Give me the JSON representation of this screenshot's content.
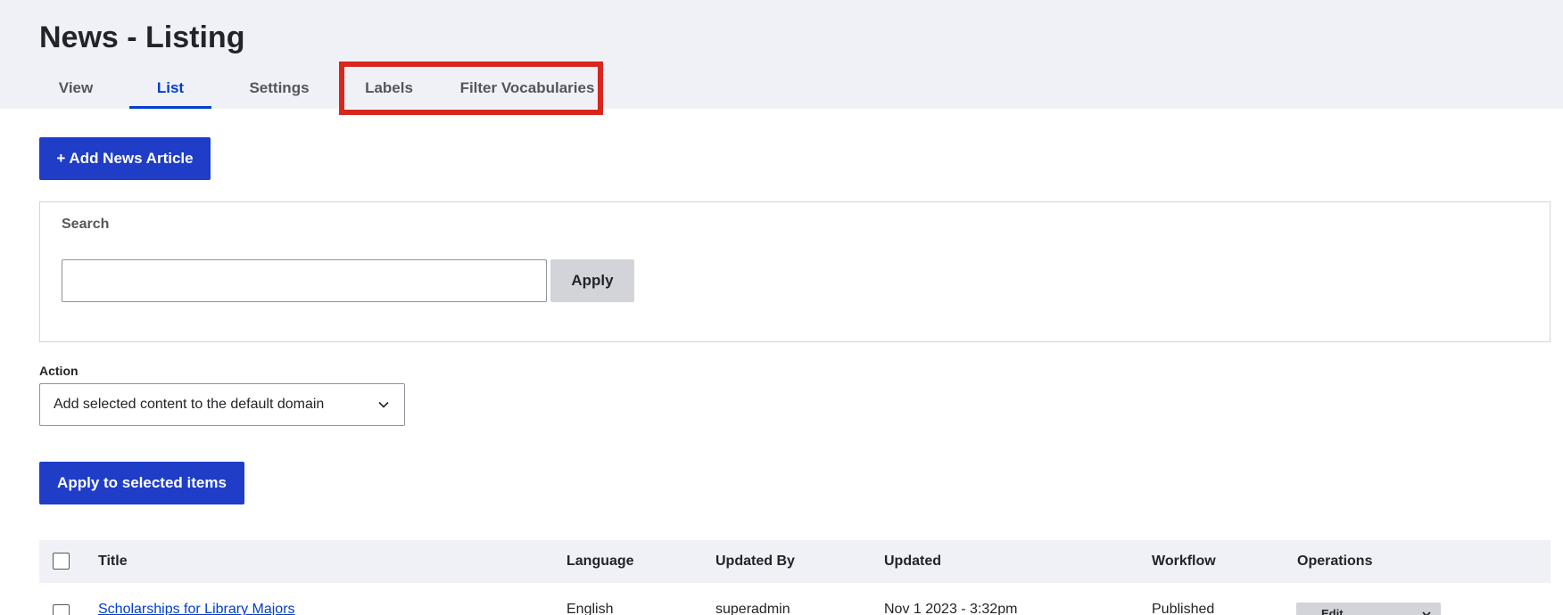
{
  "page": {
    "title": "News - Listing"
  },
  "tabs": [
    {
      "label": "View",
      "active": false
    },
    {
      "label": "List",
      "active": true
    },
    {
      "label": "Settings",
      "active": false
    },
    {
      "label": "Labels",
      "active": false
    },
    {
      "label": "Filter Vocabularies",
      "active": false
    }
  ],
  "buttons": {
    "add_article": "+ Add News Article",
    "apply": "Apply",
    "apply_selected": "Apply to selected items"
  },
  "search": {
    "label": "Search",
    "value": "",
    "placeholder": ""
  },
  "action": {
    "label": "Action",
    "selected": "Add selected content to the default domain"
  },
  "table": {
    "columns": [
      "Title",
      "Language",
      "Updated By",
      "Updated",
      "Workflow",
      "Operations"
    ],
    "rows": [
      {
        "title": "Scholarships for Library Majors",
        "language": "English",
        "updated_by": "superadmin",
        "updated": "Nov 1 2023 - 3:32pm",
        "workflow": "Published",
        "operation": "Edit"
      }
    ]
  },
  "colors": {
    "accent": "#003ecc",
    "primary_button": "#1f3dc7",
    "highlight": "#d8261d",
    "header_bg": "#f0f1f6"
  }
}
